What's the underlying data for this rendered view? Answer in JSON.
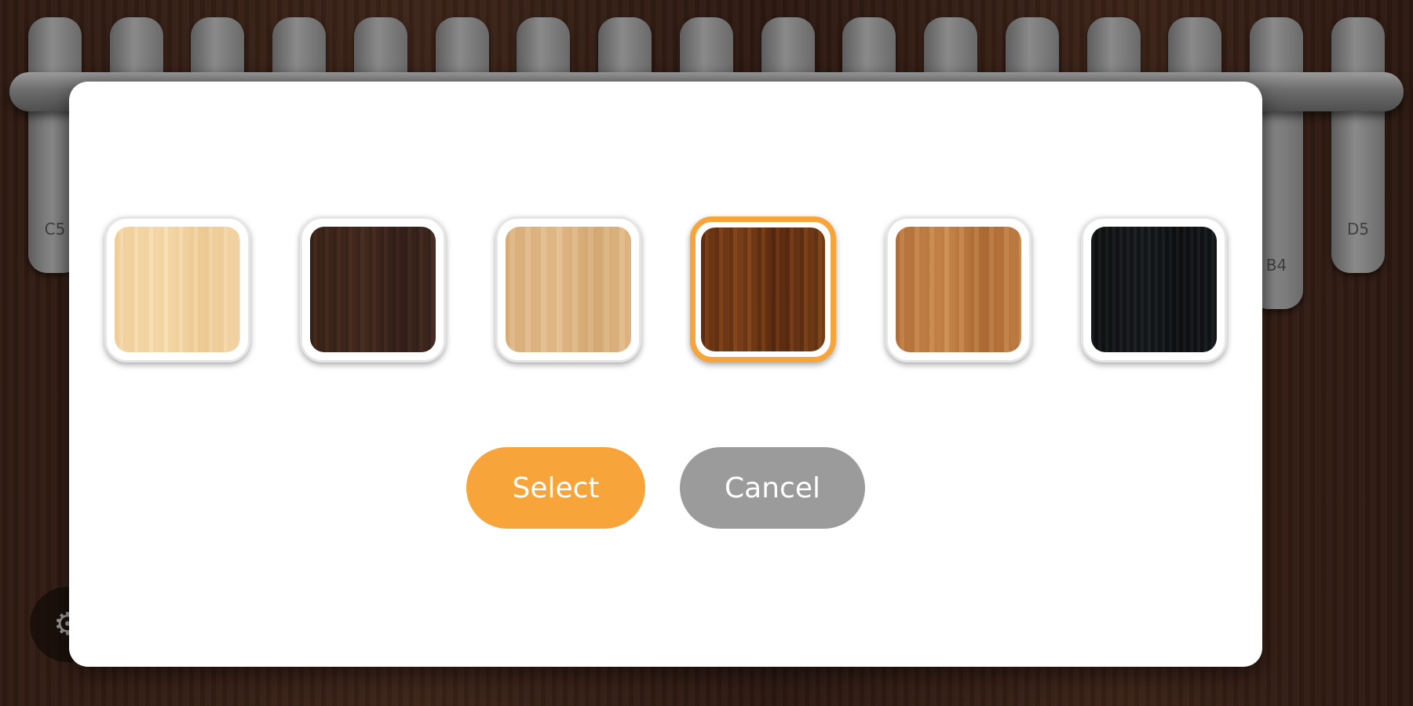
{
  "app": {
    "tines": [
      {
        "label": "C5"
      },
      {
        "label": ""
      },
      {
        "label": ""
      },
      {
        "label": ""
      },
      {
        "label": ""
      },
      {
        "label": ""
      },
      {
        "label": ""
      },
      {
        "label": ""
      },
      {
        "label": ""
      },
      {
        "label": ""
      },
      {
        "label": ""
      },
      {
        "label": ""
      },
      {
        "label": ""
      },
      {
        "label": ""
      },
      {
        "label": ""
      },
      {
        "label": "B4"
      },
      {
        "label": "D5"
      }
    ],
    "settings_icon": "gear-icon"
  },
  "dialog": {
    "swatches": [
      {
        "name": "wood-maple",
        "selected": false
      },
      {
        "name": "wood-dark-walnut",
        "selected": false
      },
      {
        "name": "wood-ash",
        "selected": false
      },
      {
        "name": "wood-rosewood",
        "selected": true
      },
      {
        "name": "wood-teak",
        "selected": false
      },
      {
        "name": "wood-ebony",
        "selected": false
      }
    ],
    "select_label": "Select",
    "cancel_label": "Cancel"
  },
  "colors": {
    "accent": "#f7a53a",
    "cancel": "#9b9b9b",
    "dialog_bg": "#ffffff",
    "background_wood": "#3b2318",
    "tine": "#7a7a7a"
  }
}
